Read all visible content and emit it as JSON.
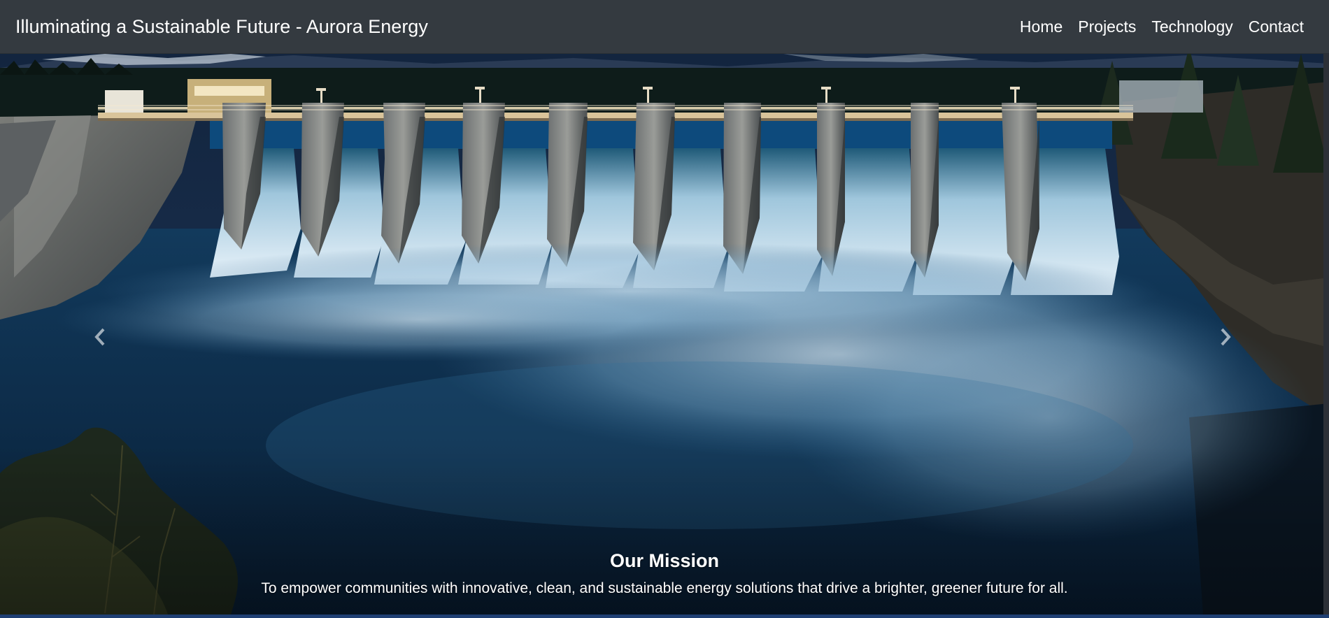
{
  "navbar": {
    "brand": "Illuminating a Sustainable Future - Aurora Energy",
    "links": [
      {
        "label": "Home"
      },
      {
        "label": "Projects"
      },
      {
        "label": "Technology"
      },
      {
        "label": "Contact"
      }
    ]
  },
  "carousel": {
    "prev_icon": "chevron-left-icon",
    "next_icon": "chevron-right-icon",
    "image_subject": "hydroelectric-dam",
    "caption": {
      "title": "Our Mission",
      "text": "To empower communities with innovative, clean, and sustainable energy solutions that drive a brighter, greener future for all."
    }
  },
  "colors": {
    "navbar_bg": "#343a40",
    "text": "#ffffff",
    "bottom_accent": "#1f3f73"
  }
}
